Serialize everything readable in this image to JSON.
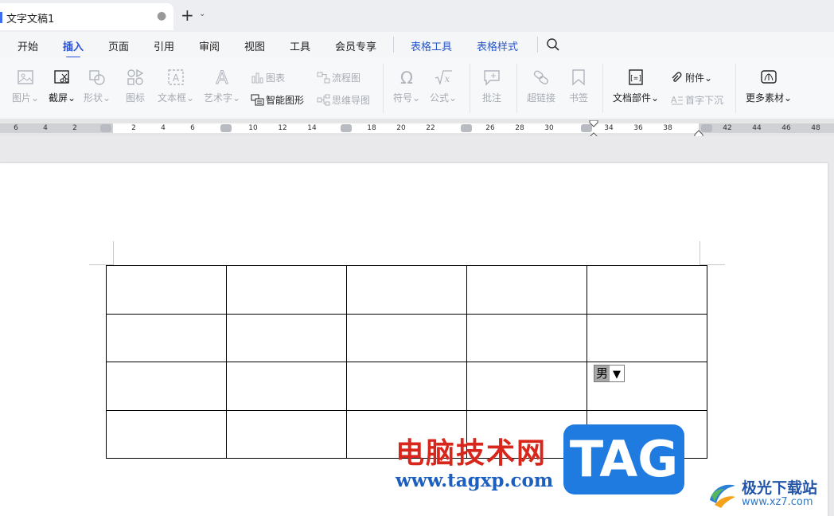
{
  "tab": {
    "title": "文字文稿1",
    "modified_dot": "●",
    "new_tab": "+",
    "new_tab_dropdown": "⌄"
  },
  "menu": {
    "items": [
      "开始",
      "插入",
      "页面",
      "引用",
      "审阅",
      "视图",
      "工具",
      "会员专享",
      "表格工具",
      "表格样式"
    ],
    "active": "插入"
  },
  "ribbon": {
    "picture": "图片",
    "screenshot": "截屏",
    "shape": "形状",
    "icon": "图标",
    "textbox": "文本框",
    "wordart": "艺术字",
    "chart": "图表",
    "smartart": "智能图形",
    "flowchart": "流程图",
    "mindmap": "思维导图",
    "symbol": "符号",
    "formula": "公式",
    "comment": "批注",
    "hyperlink": "超链接",
    "bookmark": "书签",
    "doc_parts": "文档部件",
    "attachment": "附件",
    "drop_cap": "首字下沉",
    "more_assets": "更多素材"
  },
  "ruler": {
    "ticks": [
      "6",
      "4",
      "2",
      "2",
      "4",
      "6",
      "10",
      "12",
      "14",
      "18",
      "20",
      "22",
      "26",
      "28",
      "30",
      "34",
      "36",
      "38",
      "42",
      "44",
      "46",
      "48"
    ]
  },
  "document": {
    "dropdown_value": "男",
    "dropdown_arrow": "▼"
  },
  "watermark": {
    "cn_text": "电脑技术网",
    "url": "www.tagxp.com",
    "tag": "TAG",
    "site_name": "极光下载站",
    "site_url": "www.xz7.com"
  },
  "colors": {
    "accent": "#2850d8",
    "watermark_red": "#d9261c",
    "watermark_blue": "#1f7be0"
  }
}
